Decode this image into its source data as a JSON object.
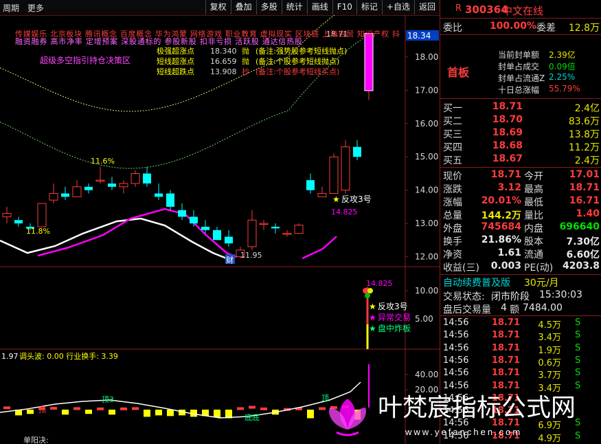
{
  "toolbar": {
    "period": "周期",
    "more": "更多",
    "buttons": [
      "复权",
      "叠加",
      "多股",
      "统计",
      "画线",
      "F10",
      "标记",
      "+自选",
      "返回"
    ]
  },
  "colors": {
    "up": "#ff3c3c",
    "down": "#00ffff",
    "magenta": "#ff00ff",
    "yellow": "#ffff00",
    "panel_border": "#8a1a1a"
  },
  "main_chart": {
    "concepts_line1": "传媒娱乐 北京板块 腾讯概念 百度概念 华为鸿蒙 网络游戏 职业教育 虚拟现实 区块链 上海自贸 知识产权 抖",
    "concepts_line2": "融资融券 高市净率 定增预案 深股通标的 参股新股 扣非亏损 活跃股 通达信热股",
    "indicator_title": "超级多空指引持仓决策区",
    "legend": [
      {
        "name": "极强超涨点",
        "value": "18.340",
        "action": "抛",
        "note": "(备注:强势股参考短线抛点)"
      },
      {
        "name": "短线超涨点",
        "value": "16.659",
        "action": "抛",
        "note": "(备注:个股参考短线抛点)"
      },
      {
        "name": "短线超跌点",
        "value": "13.908",
        "action": "抄",
        "note": "(备注:个股参考短线买点)"
      }
    ],
    "price_box": "18.34",
    "high_label": "18.71",
    "y_ticks": [
      "18.00",
      "17.00",
      "16.00",
      "15.00",
      "14.00",
      "13.00",
      "12.00"
    ],
    "annotations": {
      "pct_top": "11.6%",
      "pct_bottom": "11.8%",
      "low_value": "11.95",
      "cai": "财",
      "fangong": "反攻3号",
      "price_14825": "14.825"
    }
  },
  "sub_chart1": {
    "y_ticks": [
      "10.00",
      "5.00"
    ],
    "top_label": "14.825",
    "signals": [
      "反攻3号",
      "异常交易",
      "盘中炸板"
    ]
  },
  "sub_chart2": {
    "title_value": "1.97",
    "title_line": "调头波: 0.00  行业换手: 3.39",
    "y_ticks": [
      "40.00",
      "20.00"
    ],
    "labels": [
      "顶3",
      "顶",
      "底底",
      "顶"
    ],
    "bottom_label": "单阳决:"
  },
  "chart_data": {
    "type": "candlestick",
    "title": "",
    "ylim": [
      11.5,
      19.0
    ],
    "series": [
      {
        "name": "K线",
        "candles": [
          [
            13.2,
            13.5,
            13.0,
            13.3
          ],
          [
            13.1,
            13.2,
            12.9,
            13.0
          ],
          [
            12.9,
            13.0,
            12.8,
            12.85
          ],
          [
            12.9,
            13.6,
            12.9,
            13.6
          ],
          [
            13.7,
            14.2,
            13.6,
            13.9
          ],
          [
            13.9,
            14.1,
            13.7,
            13.8
          ],
          [
            13.8,
            14.3,
            13.8,
            14.1
          ],
          [
            14.1,
            14.2,
            13.9,
            14.0
          ],
          [
            14.3,
            14.7,
            14.2,
            14.3
          ],
          [
            14.2,
            14.4,
            14.0,
            14.1
          ],
          [
            14.1,
            14.3,
            13.9,
            14.2
          ],
          [
            14.2,
            14.6,
            14.1,
            14.5
          ],
          [
            14.5,
            14.7,
            14.1,
            14.2
          ],
          [
            13.9,
            14.2,
            13.7,
            13.8
          ],
          [
            13.9,
            14.0,
            13.4,
            13.5
          ],
          [
            13.4,
            13.6,
            13.1,
            13.2
          ],
          [
            13.2,
            13.4,
            12.9,
            13.0
          ],
          [
            12.9,
            13.1,
            12.7,
            12.8
          ],
          [
            12.8,
            12.9,
            12.5,
            12.5
          ],
          [
            12.6,
            12.8,
            12.3,
            12.4
          ],
          [
            12.0,
            12.3,
            11.95,
            12.2
          ],
          [
            12.3,
            13.4,
            12.2,
            13.1
          ],
          [
            13.0,
            13.1,
            12.8,
            13.0
          ],
          [
            12.9,
            13.0,
            12.7,
            12.85
          ],
          [
            12.7,
            12.8,
            12.6,
            12.7
          ],
          [
            12.7,
            13.0,
            12.7,
            12.95
          ],
          [
            14.3,
            14.5,
            13.9,
            14.0
          ],
          [
            13.8,
            14.1,
            13.8,
            13.9
          ],
          [
            13.9,
            15.1,
            13.9,
            15.0
          ],
          [
            14.0,
            15.5,
            13.9,
            15.3
          ],
          [
            15.3,
            15.5,
            14.9,
            15.0
          ],
          [
            16.99,
            18.71,
            16.71,
            18.71
          ]
        ]
      }
    ],
    "volume": [
      12,
      8,
      6,
      9,
      10,
      7,
      9,
      6,
      8,
      7,
      8,
      9,
      10,
      8,
      9,
      8,
      10,
      9,
      11,
      12,
      9,
      14,
      8,
      7,
      6,
      8,
      12,
      9,
      13,
      16,
      14,
      35
    ],
    "sub_volume": [
      0,
      0,
      0,
      0,
      0,
      0,
      0,
      0,
      0,
      0,
      0,
      0,
      0,
      0,
      0,
      0,
      0,
      0,
      0,
      0,
      0,
      0,
      0,
      0,
      0,
      0,
      0,
      0,
      0,
      0,
      0,
      14.825
    ]
  },
  "panel": {
    "code": "300364",
    "name": "中文在线",
    "weibi_label": "委比",
    "weibi": "100.00%",
    "weicha_label": "委差",
    "weicha": "12.8万",
    "fengdan": [
      {
        "label": "当前封单额",
        "value": "2.39亿"
      },
      {
        "label": "封单占成交",
        "value": "0.09倍"
      },
      {
        "label": "封单占流通Z",
        "value": "2.25%"
      },
      {
        "label": "十日总涨幅",
        "value": "55.79%"
      }
    ],
    "shouban": "首板",
    "bids": [
      {
        "label": "买一",
        "price": "18.71",
        "vol": "2.4亿"
      },
      {
        "label": "买二",
        "price": "18.70",
        "vol": "83.6万"
      },
      {
        "label": "买三",
        "price": "18.69",
        "vol": "13.8万"
      },
      {
        "label": "买四",
        "price": "18.68",
        "vol": "11.2万"
      },
      {
        "label": "买五",
        "price": "18.67",
        "vol": "2.4万"
      }
    ],
    "quote": [
      {
        "l1": "现价",
        "v1": "18.71",
        "l2": "今开",
        "v2": "17.01",
        "c1": "red",
        "c2": "red"
      },
      {
        "l1": "涨跌",
        "v1": "3.12",
        "l2": "最高",
        "v2": "18.71",
        "c1": "red",
        "c2": "red"
      },
      {
        "l1": "涨幅",
        "v1": "20.01%",
        "l2": "最低",
        "v2": "16.71",
        "c1": "red",
        "c2": "red"
      },
      {
        "l1": "总量",
        "v1": "144.2万",
        "l2": "量比",
        "v2": "1.40",
        "c1": "yel",
        "c2": "red"
      },
      {
        "l1": "外盘",
        "v1": "745684",
        "l2": "内盘",
        "v2": "696640",
        "c1": "red",
        "c2": "grn"
      },
      {
        "l1": "换手",
        "v1": "21.86%",
        "l2": "股本",
        "v2": "7.30亿",
        "c1": "wht",
        "c2": "wht"
      },
      {
        "l1": "净资",
        "v1": "1.61",
        "l2": "流通",
        "v2": "6.60亿",
        "c1": "wht",
        "c2": "wht"
      },
      {
        "l1": "收益(三)",
        "v1": "0.003",
        "l2": "PE(动)",
        "v2": "4203.8",
        "c1": "wht",
        "c2": "wht"
      }
    ],
    "ad_text": "自动续费普及版",
    "ad_price": "30元/月",
    "trade_status_label": "交易状态:",
    "trade_status": "闭市阶段",
    "trade_time": "15:30:03",
    "after_label": "盘后交易量",
    "after_count": "4",
    "after_amt_label": "额",
    "after_amt": "7484.00",
    "trades": [
      {
        "t": "14:56",
        "p": "18.71",
        "v": "4.5万",
        "s": "S"
      },
      {
        "t": "14:56",
        "p": "18.71",
        "v": "3.4万",
        "s": "S"
      },
      {
        "t": "14:56",
        "p": "18.71",
        "v": "1.9万",
        "s": "S"
      },
      {
        "t": "14:56",
        "p": "18.71",
        "v": "0.6万",
        "s": "S"
      },
      {
        "t": "14:56",
        "p": "18.71",
        "v": "3.7万",
        "s": "S"
      },
      {
        "t": "14:56",
        "p": "18.71",
        "v": "3.4万",
        "s": "S"
      },
      {
        "t": "14:56",
        "p": "18.71",
        "v": "",
        "s": ""
      },
      {
        "t": "14:56",
        "p": "18.71",
        "v": "",
        "s": ""
      },
      {
        "t": "14:56",
        "p": "18.71",
        "v": "6.9万",
        "s": "S"
      },
      {
        "t": "14:56",
        "p": "18.71",
        "v": "4.9万",
        "s": "S"
      }
    ]
  },
  "watermark": {
    "text": "叶梵宸指标公式网",
    "url": "www.yefanchen.com"
  }
}
